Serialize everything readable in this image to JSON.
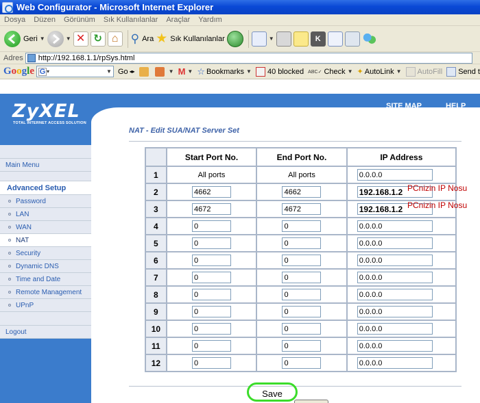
{
  "window": {
    "title": "Web Configurator - Microsoft Internet Explorer"
  },
  "menu": [
    "Dosya",
    "Düzen",
    "Görünüm",
    "Sık Kullanılanlar",
    "Araçlar",
    "Yardım"
  ],
  "toolbar": {
    "back_label": "Geri",
    "search_label": "Ara",
    "favorites_label": "Sık Kullanılanlar"
  },
  "address": {
    "label": "Adres",
    "url": "http://192.168.1.1/rpSys.html"
  },
  "google_bar": {
    "logo": "Google",
    "search_prefix": "G",
    "go_label": "Go",
    "bookmarks_label": "Bookmarks",
    "blocked_label": "40 blocked",
    "check_label": "Check",
    "autolink_label": "AutoLink",
    "autofill_label": "AutoFill",
    "send_label": "Send t"
  },
  "brand": {
    "logo": "ZyXEL",
    "tagline": "TOTAL INTERNET ACCESS SOLUTION"
  },
  "topnav": {
    "site_map": "SITE MAP",
    "help": "HELP"
  },
  "sidebar": {
    "main_menu": "Main Menu",
    "advanced_setup": "Advanced Setup",
    "items": [
      "Password",
      "LAN",
      "WAN",
      "NAT",
      "Security",
      "Dynamic DNS",
      "Time and Date",
      "Remote Management",
      "UPnP"
    ],
    "active": "NAT",
    "logout": "Logout"
  },
  "page": {
    "title": "NAT - Edit SUA/NAT Server Set"
  },
  "table": {
    "headers": [
      "",
      "Start Port No.",
      "End Port No.",
      "IP Address"
    ],
    "first_row": {
      "index": "1",
      "start": "All ports",
      "end": "All ports",
      "ip": "0.0.0.0"
    },
    "rows": [
      {
        "index": "2",
        "start": "4662",
        "end": "4662",
        "ip": "192.168.1.2"
      },
      {
        "index": "3",
        "start": "4672",
        "end": "4672",
        "ip": "192.168.1.2"
      },
      {
        "index": "4",
        "start": "0",
        "end": "0",
        "ip": "0.0.0.0"
      },
      {
        "index": "5",
        "start": "0",
        "end": "0",
        "ip": "0.0.0.0"
      },
      {
        "index": "6",
        "start": "0",
        "end": "0",
        "ip": "0.0.0.0"
      },
      {
        "index": "7",
        "start": "0",
        "end": "0",
        "ip": "0.0.0.0"
      },
      {
        "index": "8",
        "start": "0",
        "end": "0",
        "ip": "0.0.0.0"
      },
      {
        "index": "9",
        "start": "0",
        "end": "0",
        "ip": "0.0.0.0"
      },
      {
        "index": "10",
        "start": "0",
        "end": "0",
        "ip": "0.0.0.0"
      },
      {
        "index": "11",
        "start": "0",
        "end": "0",
        "ip": "0.0.0.0"
      },
      {
        "index": "12",
        "start": "0",
        "end": "0",
        "ip": "0.0.0.0"
      }
    ]
  },
  "annotation": "PCnizin IP Nosu",
  "buttons": {
    "save": "Save"
  },
  "colors": {
    "brand_blue": "#3b7ccc",
    "highlight_green": "#3bdc2a",
    "annotation_red": "#c00000"
  }
}
